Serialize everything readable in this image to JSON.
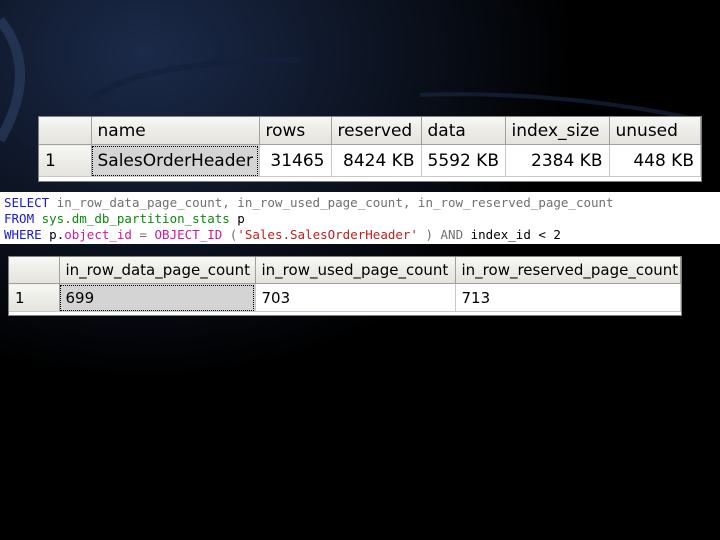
{
  "grid1": {
    "columns": [
      "",
      "name",
      "rows",
      "reserved",
      "data",
      "index_size",
      "unused"
    ],
    "rows": [
      [
        "1",
        "SalesOrderHeader",
        "31465",
        "8424 KB",
        "5592 KB",
        "2384 KB",
        "448 KB"
      ]
    ]
  },
  "sql": {
    "line1": {
      "kw": "SELECT",
      "rest": " in_row_data_page_count, in_row_used_page_count, in_row_reserved_page_count"
    },
    "line2": {
      "kw": "FROM",
      "obj": " sys.dm_db_partition_stats",
      "rest": " p"
    },
    "line3": {
      "kw": "WHERE",
      "p1": " p.",
      "col": "object_id",
      "op": " = ",
      "fn": "OBJECT_ID",
      "open": " (",
      "str": "'Sales.SalesOrderHeader'",
      "close": " ) ",
      "and": "AND",
      "tail": " index_id < 2"
    }
  },
  "grid2": {
    "columns": [
      "",
      "in_row_data_page_count",
      "in_row_used_page_count",
      "in_row_reserved_page_count"
    ],
    "rows": [
      [
        "1",
        "699",
        "703",
        "713"
      ]
    ]
  },
  "theme": {
    "background": "#000000",
    "accent": "#0a1a3a"
  }
}
